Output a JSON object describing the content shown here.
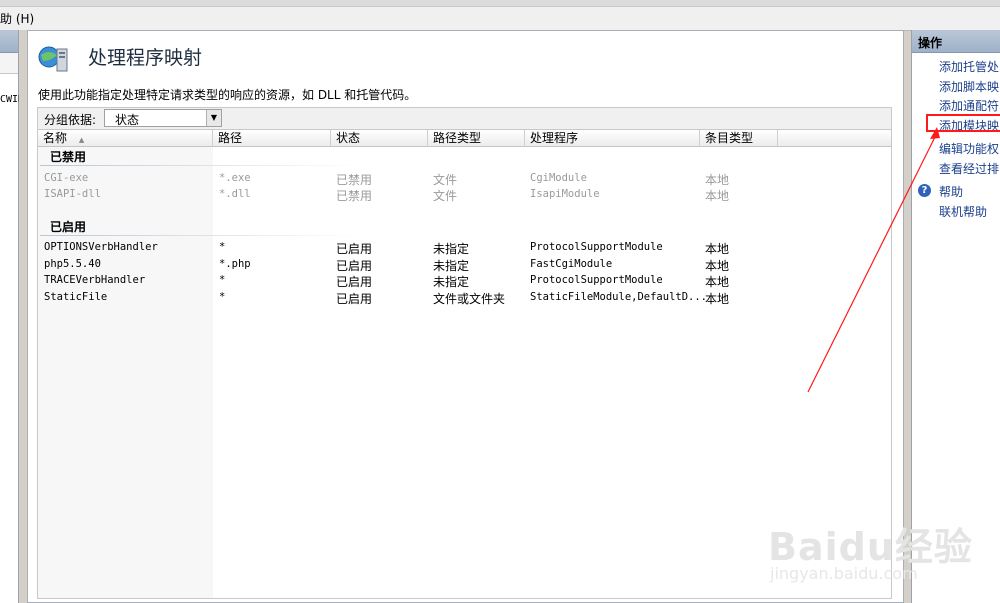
{
  "menubar": {
    "help_menu": "助 (H)"
  },
  "left_panel": {
    "item": "CWIN"
  },
  "main": {
    "title": "处理程序映射",
    "description": "使用此功能指定处理特定请求类型的响应的资源，如 DLL 和托管代码。",
    "group_by_label": "分组依据:",
    "group_by_value": "状态",
    "columns": [
      "名称",
      "路径",
      "状态",
      "路径类型",
      "处理程序",
      "条目类型"
    ],
    "groups": [
      {
        "label": "已禁用",
        "rows": [
          {
            "name": "CGI-exe",
            "path": "*.exe",
            "state": "已禁用",
            "path_type": "文件",
            "handler": "CgiModule",
            "entry_type": "本地"
          },
          {
            "name": "ISAPI-dll",
            "path": "*.dll",
            "state": "已禁用",
            "path_type": "文件",
            "handler": "IsapiModule",
            "entry_type": "本地"
          }
        ]
      },
      {
        "label": "已启用",
        "rows": [
          {
            "name": "OPTIONSVerbHandler",
            "path": "*",
            "state": "已启用",
            "path_type": "未指定",
            "handler": "ProtocolSupportModule",
            "entry_type": "本地"
          },
          {
            "name": "php5.5.40",
            "path": "*.php",
            "state": "已启用",
            "path_type": "未指定",
            "handler": "FastCgiModule",
            "entry_type": "本地"
          },
          {
            "name": "TRACEVerbHandler",
            "path": "*",
            "state": "已启用",
            "path_type": "未指定",
            "handler": "ProtocolSupportModule",
            "entry_type": "本地"
          },
          {
            "name": "StaticFile",
            "path": "*",
            "state": "已启用",
            "path_type": "文件或文件夹",
            "handler": "StaticFileModule,DefaultD...",
            "entry_type": "本地"
          }
        ]
      }
    ]
  },
  "actions": {
    "header": "操作",
    "links": [
      "添加托管处",
      "添加脚本映",
      "添加通配符",
      "添加模块映",
      "编辑功能权",
      "查看经过排"
    ],
    "help_header": "帮助",
    "help_links": [
      "联机帮助"
    ]
  },
  "colors": {
    "highlight": "#ff1a1a",
    "link": "#1c3f8c",
    "header_blue": "#9fb2c9"
  },
  "watermark": {
    "brand": "Baidu经验",
    "sub": "jingyan.baidu.com"
  }
}
